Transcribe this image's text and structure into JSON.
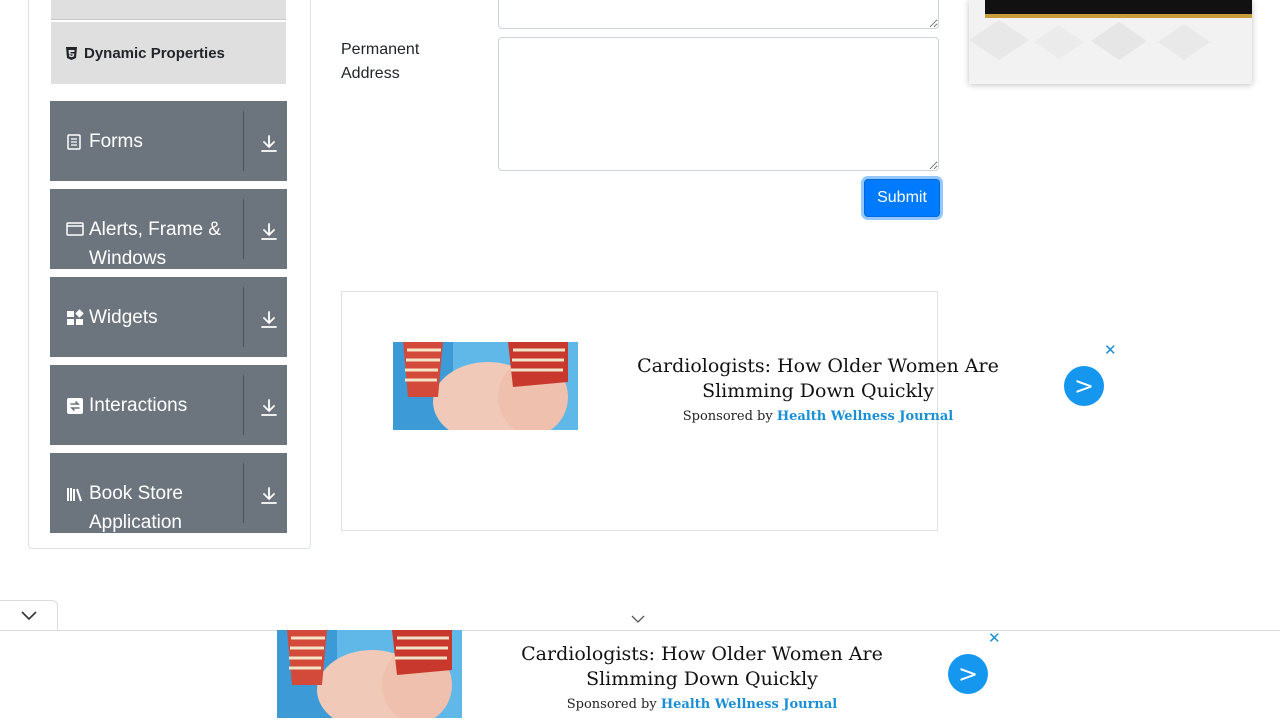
{
  "sidebar": {
    "submenu_item": "Dynamic Properties",
    "groups": [
      {
        "label": "Forms",
        "icon": "form-icon"
      },
      {
        "label": "Alerts, Frame & Windows",
        "icon": "window-icon"
      },
      {
        "label": "Widgets",
        "icon": "widgets-icon"
      },
      {
        "label": "Interactions",
        "icon": "interactions-icon"
      },
      {
        "label": "Book Store Application",
        "icon": "books-icon"
      }
    ]
  },
  "form": {
    "permanent_address_label": "Permanent Address",
    "submit_label": "Submit"
  },
  "ads": {
    "headline": "Cardiologists: How Older Women Are Slimming Down Quickly",
    "sponsored_by": "Sponsored by",
    "brand": "Health Wellness Journal",
    "arrow": ">",
    "close": "✕"
  },
  "colors": {
    "group_bg": "#6c757d",
    "submenu_bg": "#dfdfdf",
    "primary": "#007bff",
    "ad_accent": "#1597f0"
  }
}
